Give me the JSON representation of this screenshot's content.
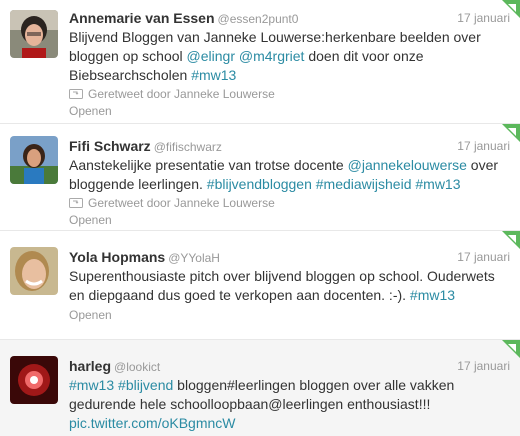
{
  "tweets": [
    {
      "name": "Annemarie van Essen",
      "handle": "@essen2punt0",
      "time": "17 januari",
      "lines": [
        [
          {
            "t": "Blijvend Bloggen van Janneke Louwerse:herkenbare beelden over"
          }
        ],
        [
          {
            "t": "bloggen op school "
          },
          {
            "t": "@elingr",
            "link": true
          },
          {
            "t": " "
          },
          {
            "t": "@m4rgriet",
            "link": true
          },
          {
            "t": " doen dit voor onze"
          }
        ],
        [
          {
            "t": "Biebsearchscholen "
          },
          {
            "t": "#mw13",
            "link": true
          }
        ]
      ],
      "retweeted_by": "Geretweet door Janneke Louwerse",
      "open_label": "Openen",
      "avatar": "avatar-annemarie"
    },
    {
      "name": "Fifi Schwarz",
      "handle": "@fifischwarz",
      "time": "17 januari",
      "lines": [
        [
          {
            "t": "Aanstekelijke presentatie van trotse docente "
          },
          {
            "t": "@jannekelouwerse",
            "link": true
          },
          {
            "t": " over"
          }
        ],
        [
          {
            "t": "bloggende leerlingen. "
          },
          {
            "t": "#blijvendbloggen",
            "link": true
          },
          {
            "t": " "
          },
          {
            "t": "#mediawijsheid",
            "link": true
          },
          {
            "t": " "
          },
          {
            "t": "#mw13",
            "link": true
          }
        ]
      ],
      "retweeted_by": "Geretweet door Janneke Louwerse",
      "open_label": "Openen",
      "avatar": "avatar-fifi"
    },
    {
      "name": "Yola Hopmans",
      "handle": "@YYolaH",
      "time": "17 januari",
      "lines": [
        [
          {
            "t": "Superenthousiaste pitch over blijvend bloggen op school. Ouderwets"
          }
        ],
        [
          {
            "t": "en diepgaand dus goed te verkopen aan docenten. :-). "
          },
          {
            "t": "#mw13",
            "link": true
          }
        ]
      ],
      "retweeted_by": "",
      "open_label": "Openen",
      "avatar": "avatar-yola"
    },
    {
      "name": "harleg",
      "handle": "@lookict",
      "time": "17 januari",
      "lines": [
        [
          {
            "t": "#mw13",
            "link": true
          },
          {
            "t": " "
          },
          {
            "t": "#blijvend",
            "link": true
          },
          {
            "t": " bloggen#leerlingen bloggen over alle vakken"
          }
        ],
        [
          {
            "t": "gedurende hele schoolloopbaan@leerlingen enthousiast!!!"
          }
        ],
        [
          {
            "t": "pic.twitter.com/oKBgmncW",
            "link": true
          }
        ]
      ],
      "retweeted_by": "",
      "open_label": "",
      "avatar": "avatar-harleg"
    }
  ],
  "colors": {
    "link": "#2b8ba3",
    "muted": "#999999",
    "text": "#333333",
    "corner_badge": "#5cb85c"
  }
}
